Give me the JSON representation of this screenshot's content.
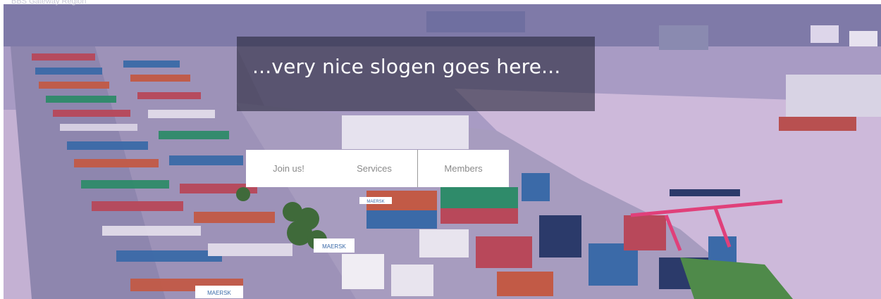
{
  "header": {
    "site_name": "BBS Gateway Region"
  },
  "hero": {
    "slogan": "...very nice slogen goes here...",
    "image_description_icon": "container-terminal-photo",
    "banner_text": [
      "MAERSK",
      "MAERSK",
      "MAERSK"
    ]
  },
  "nav": {
    "items": [
      {
        "label": "Join us!"
      },
      {
        "label": "Services"
      },
      {
        "label": "Members"
      }
    ]
  },
  "colors": {
    "overlay": "#28283c",
    "nav_bg": "#ffffff",
    "nav_text": "#8a8a8a",
    "sky": "#b19ac8",
    "water": "#c9b6d6"
  }
}
